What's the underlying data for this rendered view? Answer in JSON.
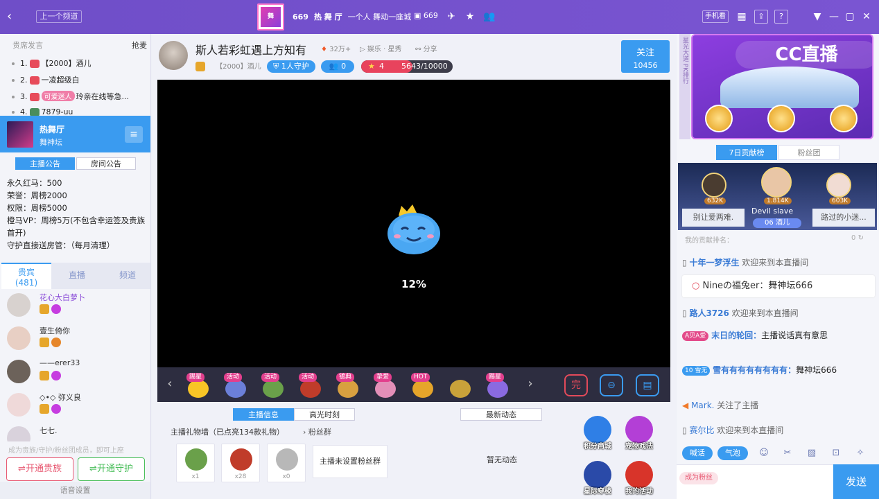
{
  "topbar": {
    "back_icon": "chevron-left-icon",
    "prev_channel": "上一个频道",
    "logo_text": "舞",
    "title_id": "669",
    "title_name": "热 舞 厅",
    "slogan": "一个人 舞动一座城",
    "room_id": "669",
    "phone_watch": "手机看",
    "icons": [
      "plane-icon",
      "star-icon",
      "users-icon",
      "grid-icon",
      "share-icon",
      "help-icon",
      "dropdown-icon",
      "minimize-icon",
      "maximize-icon",
      "close-icon"
    ],
    "help": "?"
  },
  "left": {
    "rank_header": "贵席发言",
    "grab": "抢麦",
    "rank_items": [
      {
        "num": "1.",
        "name": "【2000】酒儿",
        "tag": ""
      },
      {
        "num": "2.",
        "name": "一凌超级白",
        "tag": ""
      },
      {
        "num": "3.",
        "name": "玲亲在线等急...",
        "tag": "可爱迷人"
      },
      {
        "num": "4.",
        "name": "7879-uu",
        "tag": ""
      }
    ],
    "channel_name": "热舞厅",
    "channel_sub": "舞神坛",
    "menu_icon": "≡",
    "ann_tabs": [
      "主播公告",
      "房间公告"
    ],
    "announcement": [
      "永久红马：500",
      "荣誉：周榜2000",
      "权限：周榜5000",
      "橙马VP：周榜5万(不包含幸运签及贵族首开)",
      "守护直接送房管：（每月清理）"
    ],
    "member_tabs": {
      "vip_label": "贵宾",
      "vip_count": "(481)",
      "live": "直播",
      "channel": "频道"
    },
    "members": [
      {
        "name": "花心大白萝卜"
      },
      {
        "name": "壹生倚你"
      },
      {
        "name": "——erer33"
      },
      {
        "name": "◇•◇ 弥义良"
      },
      {
        "name": "七七."
      }
    ],
    "vip_hint": "成为贵族/守护/粉丝团成员，即可上座",
    "btn_noble": "开通贵族",
    "btn_guard": "开通守护",
    "voice_settings": "语音设置"
  },
  "center": {
    "anchor_title": "斯人若彩虹遇上方知有",
    "heat": "32万+",
    "category": "娱乐 · 星秀",
    "share": "分享",
    "fan_name": "【2000】酒儿",
    "guard": "1人守护",
    "fans_count": "0",
    "level": "4",
    "exp": "5643/10000",
    "exp_fraction": 0.5643,
    "follow_label": "关注",
    "follow_count": "10456",
    "loading_percent": "12%",
    "gifts": [
      {
        "tag": "踢星",
        "color": "#f8c526"
      },
      {
        "tag": "活动",
        "color": "#6b7fd8"
      },
      {
        "tag": "活动",
        "color": "#6aa04a"
      },
      {
        "tag": "活动",
        "color": "#c03c2a"
      },
      {
        "tag": "镀典",
        "color": "#d8a040"
      },
      {
        "tag": "挚爱",
        "color": "#e38fb8"
      },
      {
        "tag": "HOT",
        "color": "#e6a52a"
      },
      {
        "tag": "",
        "color": "#c9a23a"
      },
      {
        "tag": "踢星",
        "color": "#8a6ae0"
      }
    ],
    "info_tabs": [
      "主播信息",
      "高光时刻"
    ],
    "dynamic_tab": "最新动态",
    "gift_wall": "主播礼物墙（已点亮134款礼物）",
    "fan_group": "粉丝群",
    "wall_items": [
      {
        "count": "x1",
        "color": "#6aa04a"
      },
      {
        "count": "x28",
        "color": "#c03c2a"
      },
      {
        "count": "x0",
        "color": "#b8b8b8"
      }
    ],
    "no_fan_group": "主播未设置粉丝群",
    "no_dynamic": "暂无动态",
    "activities": [
      {
        "label": "积分商城",
        "color": "#2f7fe6"
      },
      {
        "label": "宠物戏法",
        "color": "#b33fd6"
      },
      {
        "label": "星际穿梭",
        "color": "#2a4aa8"
      },
      {
        "label": "我的活动",
        "color": "#d8342a"
      }
    ]
  },
  "right": {
    "side_tabs": "星光大道 PK排行",
    "cc_logo": "CC直播",
    "rank_tabs": [
      "7日贡献榜",
      "粉丝团"
    ],
    "podium": {
      "left_val": "632K",
      "mid_val": "1.814K",
      "right_val": "603K",
      "left_name": "别让爱两难.",
      "mid_name": "Devil slave",
      "right_name": "路过的小迷...",
      "mid_tag": "06",
      "mid_tag_name": "酒儿"
    },
    "my_rank": "我的贡献排名：",
    "my_rank_val": "0",
    "chats": [
      {
        "user": "十年一梦浮生",
        "text": "欢迎来到本直播间"
      },
      {
        "user": "Nineの福兔er：",
        "text": "舞神坛666"
      },
      {
        "user": "路人3726",
        "text": "欢迎来到本直播间"
      },
      {
        "user": "末日的轮回：",
        "text": "主播说话真有意思",
        "tag": "A贝A爱"
      },
      {
        "user": "雪有有有有有有有有：",
        "text": "舞神坛666",
        "tag": "10 雪无"
      },
      {
        "user": "Mark.",
        "text": "关注了主播"
      },
      {
        "user": "赛尔比",
        "text": "欢迎来到本直播间"
      }
    ],
    "tool_buttons": [
      "喊话",
      "气泡"
    ],
    "tool_icons": [
      "emoji-icon",
      "scissors-icon",
      "image-icon",
      "lock-icon",
      "settings-icon"
    ],
    "fan_badge": "成为粉丝",
    "send": "发送"
  }
}
